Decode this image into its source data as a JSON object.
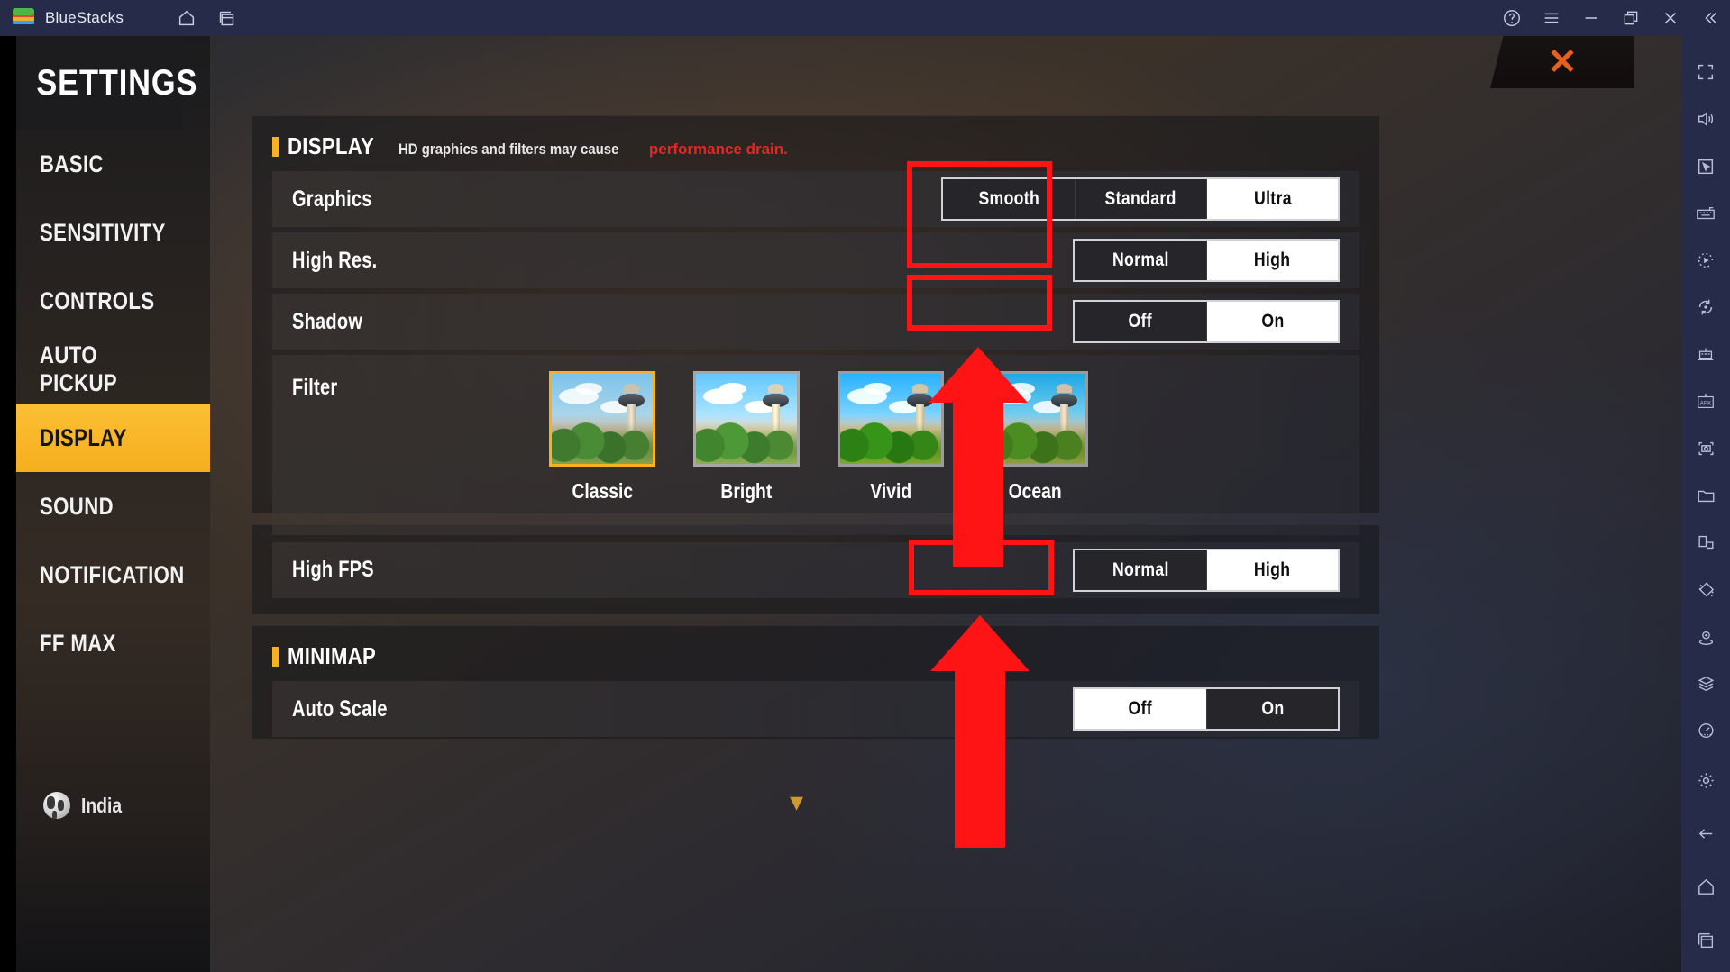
{
  "titlebar": {
    "app_name": "BlueStacks",
    "icons": [
      {
        "name": "home-icon"
      },
      {
        "name": "multi-instance-icon"
      },
      {
        "name": "help-icon"
      },
      {
        "name": "menu-icon"
      },
      {
        "name": "minimize-icon"
      },
      {
        "name": "restore-icon"
      },
      {
        "name": "close-icon"
      },
      {
        "name": "collapse-sidebar-icon"
      }
    ]
  },
  "dock": {
    "items": [
      {
        "name": "fullscreen-icon"
      },
      {
        "name": "volume-icon"
      },
      {
        "name": "cursor-icon"
      },
      {
        "name": "keyboard-controls-icon"
      },
      {
        "name": "macro-play-icon"
      },
      {
        "name": "rotate-icon"
      },
      {
        "name": "multi-instance-manager-icon"
      },
      {
        "name": "install-apk-icon"
      },
      {
        "name": "screenshot-icon"
      },
      {
        "name": "media-folder-icon"
      },
      {
        "name": "multi-window-icon"
      },
      {
        "name": "shake-icon"
      },
      {
        "name": "location-icon"
      },
      {
        "name": "layers-icon"
      },
      {
        "name": "performance-icon"
      }
    ],
    "bottom_items": [
      {
        "name": "settings-gear-icon"
      },
      {
        "name": "back-icon"
      },
      {
        "name": "android-home-icon"
      },
      {
        "name": "recent-apps-icon"
      }
    ]
  },
  "settings": {
    "title": "SETTINGS",
    "nav_items": [
      {
        "label": "BASIC",
        "active": false
      },
      {
        "label": "SENSITIVITY",
        "active": false
      },
      {
        "label": "CONTROLS",
        "active": false
      },
      {
        "label": "AUTO PICKUP",
        "active": false
      },
      {
        "label": "DISPLAY",
        "active": true
      },
      {
        "label": "SOUND",
        "active": false
      },
      {
        "label": "NOTIFICATION",
        "active": false
      },
      {
        "label": "FF MAX",
        "active": false
      }
    ],
    "region": "India",
    "close_label": "✕"
  },
  "display_section": {
    "heading": "DISPLAY",
    "note_plain": "HD graphics and filters may cause ",
    "note_highlight": "performance drain.",
    "rows": [
      {
        "label": "Graphics",
        "options": [
          "Smooth",
          "Standard",
          "Ultra"
        ],
        "selected": "Ultra",
        "highlighted": true
      },
      {
        "label": "High Res.",
        "options": [
          "Normal",
          "High"
        ],
        "selected": "High",
        "highlighted": true
      },
      {
        "label": "Shadow",
        "options": [
          "Off",
          "On"
        ],
        "selected": "On",
        "highlighted": true
      }
    ],
    "filter_row_label": "Filter",
    "filters": [
      {
        "label": "Classic",
        "selected": true
      },
      {
        "label": "Bright",
        "selected": false
      },
      {
        "label": "Vivid",
        "selected": false
      },
      {
        "label": "Ocean",
        "selected": false
      }
    ]
  },
  "fps_section": {
    "row": {
      "label": "High FPS",
      "options": [
        "Normal",
        "High"
      ],
      "selected": "High",
      "highlighted": true
    }
  },
  "minimap_section": {
    "heading": "MINIMAP",
    "row": {
      "label": "Auto Scale",
      "options": [
        "Off",
        "On"
      ],
      "selected": "Off",
      "highlighted": false
    }
  },
  "colors": {
    "accent_yellow": "#f5b223",
    "highlight_red": "#fe1414",
    "note_red": "#e8261f",
    "titlebar_navy": "#262b4a",
    "close_orange": "#e8601d"
  }
}
